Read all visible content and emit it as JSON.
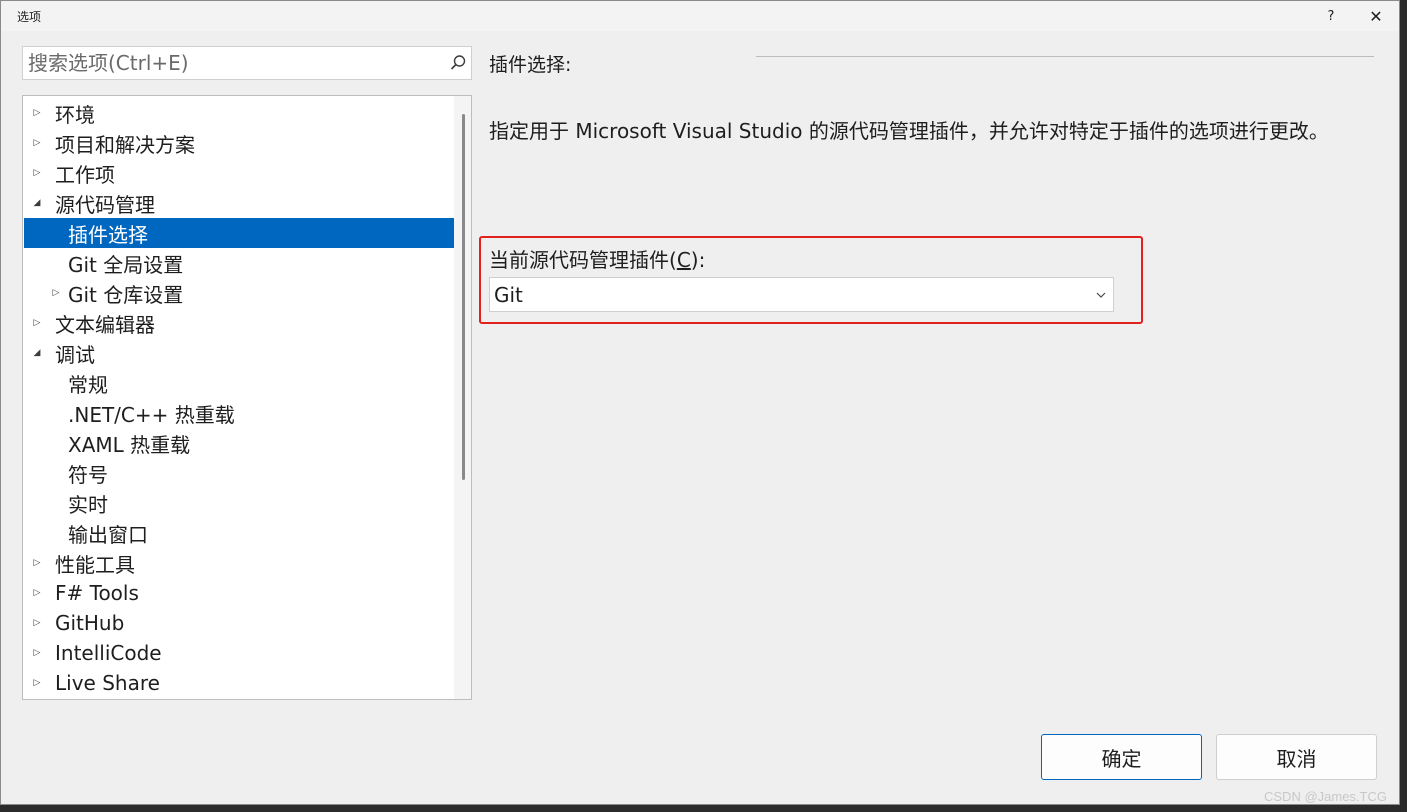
{
  "window": {
    "title": "选项",
    "help_label": "?",
    "close_label": "✕"
  },
  "search": {
    "placeholder": "搜索选项(Ctrl+E)"
  },
  "tree": [
    {
      "label": "环境",
      "arrow": "▷"
    },
    {
      "label": "项目和解决方案",
      "arrow": "▷"
    },
    {
      "label": "工作项",
      "arrow": "▷"
    },
    {
      "label": "源代码管理",
      "arrow": "◢"
    },
    {
      "label": "插件选择",
      "arrow": ""
    },
    {
      "label": "Git 全局设置",
      "arrow": ""
    },
    {
      "label": "Git 仓库设置",
      "arrow": "▷"
    },
    {
      "label": "文本编辑器",
      "arrow": "▷"
    },
    {
      "label": "调试",
      "arrow": "◢"
    },
    {
      "label": "常规",
      "arrow": ""
    },
    {
      "label": ".NET/C++ 热重载",
      "arrow": ""
    },
    {
      "label": "XAML 热重载",
      "arrow": ""
    },
    {
      "label": "符号",
      "arrow": ""
    },
    {
      "label": "实时",
      "arrow": ""
    },
    {
      "label": "输出窗口",
      "arrow": ""
    },
    {
      "label": "性能工具",
      "arrow": "▷"
    },
    {
      "label": "F# Tools",
      "arrow": "▷"
    },
    {
      "label": "GitHub",
      "arrow": "▷"
    },
    {
      "label": "IntelliCode",
      "arrow": "▷"
    },
    {
      "label": "Live Share",
      "arrow": "▷"
    }
  ],
  "panel": {
    "title": "插件选择:",
    "description": "指定用于 Microsoft Visual Studio 的源代码管理插件，并允许对特定于插件的选项进行更改。",
    "plugin_label_pre": "当前源代码管理插件(",
    "plugin_label_key": "C",
    "plugin_label_post": "):",
    "plugin_value": "Git"
  },
  "buttons": {
    "ok": "确定",
    "cancel": "取消"
  },
  "watermark": "CSDN @James.TCG",
  "colors": {
    "selection": "#0067c0",
    "highlight_border": "#e0211c"
  }
}
